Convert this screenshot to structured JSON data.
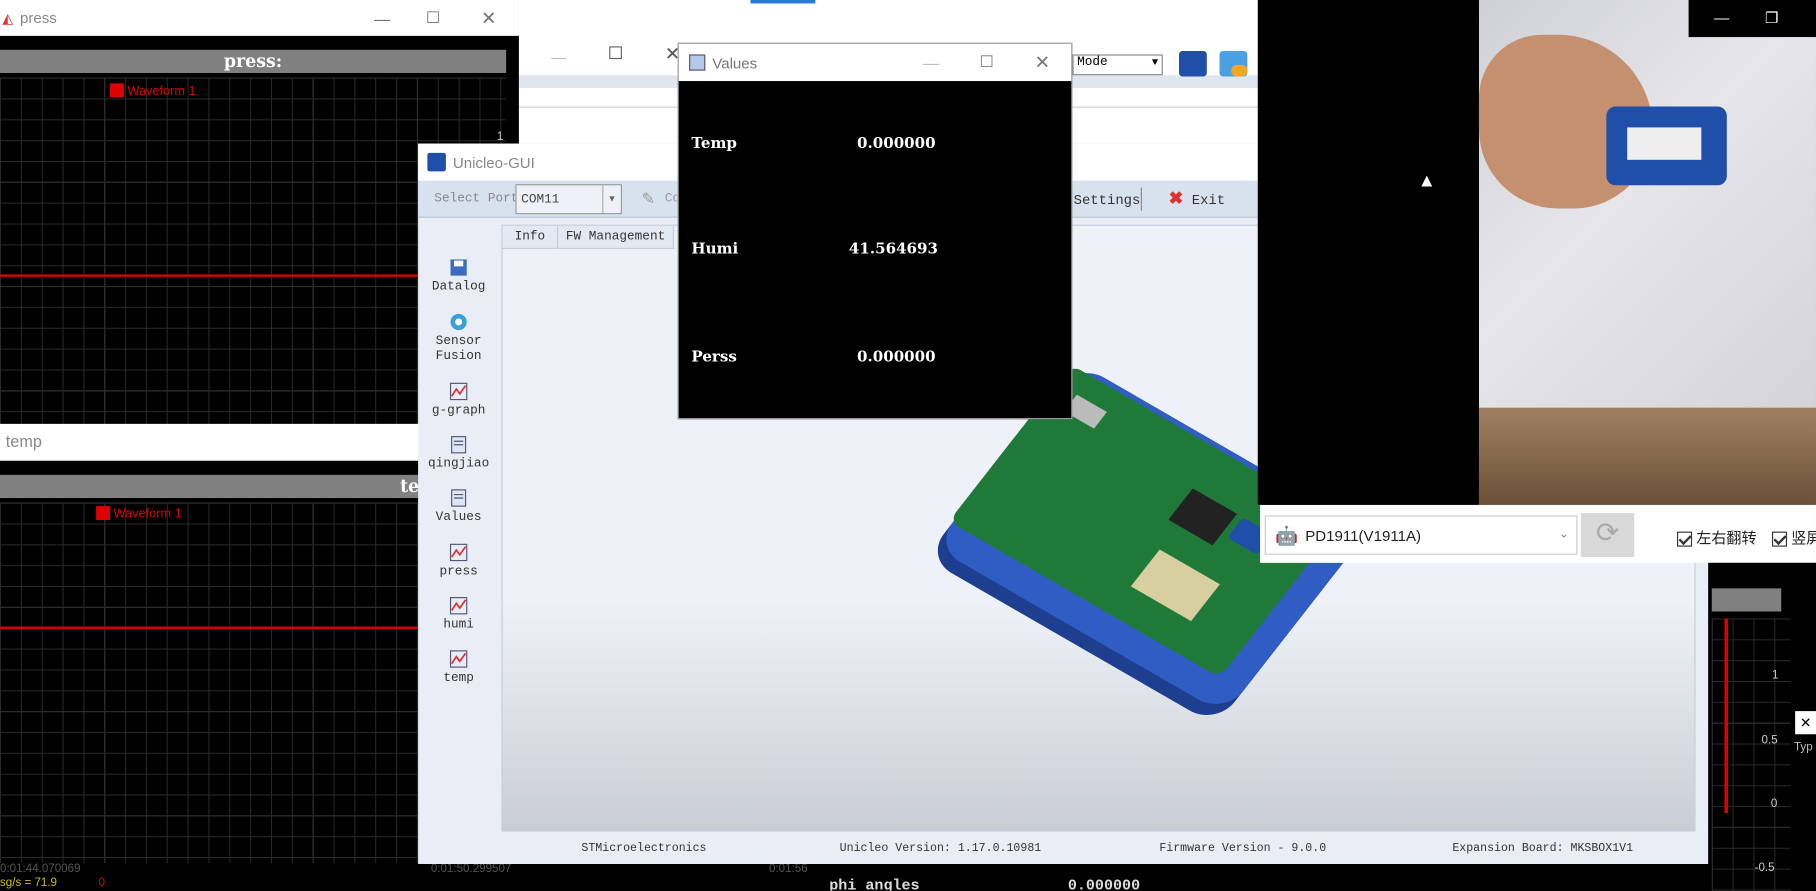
{
  "press_window": {
    "title": "press",
    "plot_title": "press:",
    "legend": "Waveform 1",
    "temp_field": "temp",
    "axis_val": "1"
  },
  "temp_plot": {
    "title": "te",
    "legend": "Waveform 1",
    "time1": "0:01:44.070069",
    "time2": "0:01:50.299507",
    "time3": "0:01:56",
    "status": "sg/s = 71.9",
    "status2": "0"
  },
  "values_window": {
    "title": "Values",
    "rows": [
      {
        "label": "Temp",
        "value": "0.000000"
      },
      {
        "label": "Humi",
        "value": "41.564693"
      },
      {
        "label": "Perss",
        "value": "0.000000"
      }
    ]
  },
  "unicleo": {
    "title": "Unicleo-GUI",
    "select_port_label": "Select Port",
    "port_value": "COM11",
    "connect_label": "Co",
    "settings_label": "Settings",
    "exit_label": "Exit",
    "tabs": [
      "Info",
      "FW Management"
    ],
    "sidebar": [
      {
        "label": "Datalog",
        "icon": "floppy-icon"
      },
      {
        "label": "Sensor\nFusion",
        "icon": "fusion-icon"
      },
      {
        "label": "g-graph",
        "icon": "graph-icon"
      },
      {
        "label": "qingjiao",
        "icon": "doc-icon"
      },
      {
        "label": "Values",
        "icon": "doc-icon"
      },
      {
        "label": "press",
        "icon": "graph-icon"
      },
      {
        "label": "humi",
        "icon": "graph-icon"
      },
      {
        "label": "temp",
        "icon": "graph-icon"
      }
    ],
    "footer": {
      "company": "STMicroelectronics",
      "version_label": "Unicleo Version:",
      "version": "1.17.0.10981",
      "fw_label": "Firmware Version -",
      "fw": "9.0.0",
      "board_label": "Expansion Board:",
      "board": "MKSBOX1V1"
    }
  },
  "top_bar": {
    "mode_label": "Mode"
  },
  "phone_bar": {
    "device": "PD1911(V1911A)",
    "flip_h": "左右翻转",
    "flip_v": "竖屏"
  },
  "bottom": {
    "phi_label": "phi angles",
    "phi_value": "0.000000"
  },
  "right_plot": {
    "ticks": [
      "1",
      "0.5",
      "0",
      "-0.5"
    ],
    "type_label": "Typ"
  },
  "colors": {
    "wave": "#e00000",
    "st_blue": "#1f4fa8",
    "grid": "#4a4a4a"
  }
}
